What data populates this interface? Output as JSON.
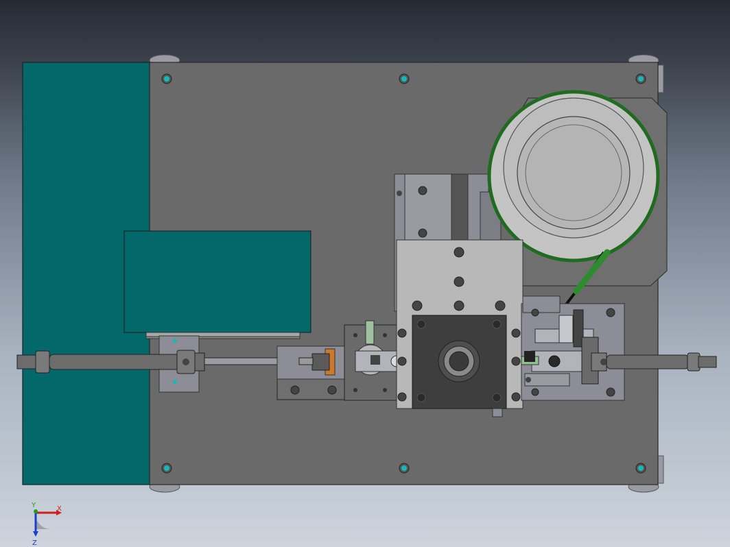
{
  "viewport": {
    "background_top": "#262a33",
    "background_bottom": "#cdd4dc"
  },
  "colors": {
    "plate": "#6a6a6a",
    "plate_edge": "#2a2a2a",
    "teal_panel": "#04676a",
    "steel_light": "#9a9aa3",
    "steel_mid": "#7f7f88",
    "steel_dark": "#4a4a4a",
    "bowl_rim": "#1f6b1f",
    "bowl_face": "#b4b4b4",
    "feed_track": "#2e8b2e",
    "bolt_cyan": "#17b8b8",
    "cylinder": "#6c6c6c"
  },
  "assembly": {
    "components": [
      "base-plate",
      "control-box-panel",
      "electrical-box",
      "vibratory-bowl-feeder",
      "feed-track",
      "left-pneumatic-cylinder",
      "right-pneumatic-cylinder",
      "center-mounting-block",
      "rotary-fixture",
      "gripper-unit",
      "leveling-feet"
    ]
  },
  "triad": {
    "x_label": "X",
    "y_label": "Y",
    "z_label": "Z",
    "x_color": "#d01e1e",
    "y_color": "#1ea01e",
    "z_color": "#1e3cd0"
  }
}
